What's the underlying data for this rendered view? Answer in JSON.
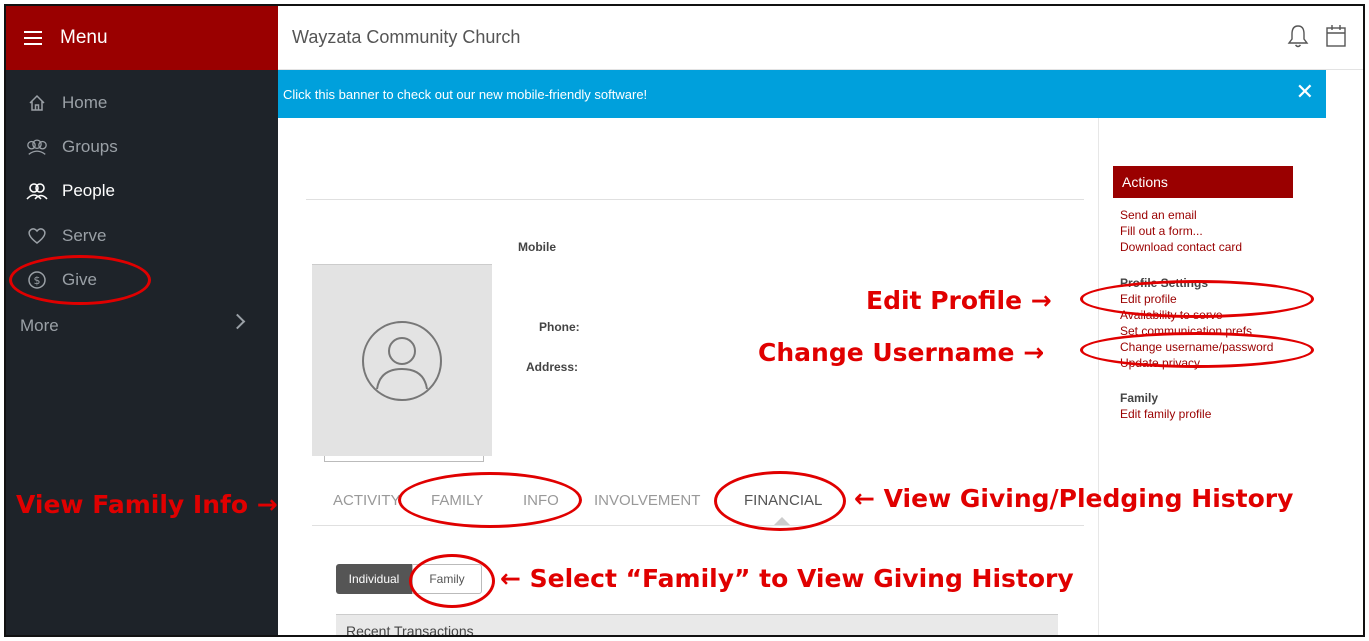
{
  "menu": {
    "label": "Menu"
  },
  "nav": {
    "home": "Home",
    "groups": "Groups",
    "people": "People",
    "serve": "Serve",
    "give": "Give",
    "more": "More"
  },
  "header": {
    "org_name": "Wayzata Community Church"
  },
  "banner": {
    "text": "Click this banner to check out our new mobile-friendly software!",
    "close": "✕"
  },
  "profile": {
    "mobile_label": "Mobile",
    "phone_label": "Phone:",
    "address_label": "Address:"
  },
  "tabs": [
    "ACTIVITY",
    "FAMILY",
    "INFO",
    "INVOLVEMENT",
    "FINANCIAL"
  ],
  "giving_toggle": {
    "individual": "Individual",
    "family": "Family"
  },
  "recent_transactions": "Recent Transactions",
  "actions": {
    "title": "Actions",
    "send_email": "Send an email",
    "fill_form": "Fill out a form...",
    "download_card": "Download contact card",
    "profile_settings_heading": "Profile Settings",
    "edit_profile": "Edit profile",
    "availability": "Availability to serve",
    "communication_prefs": "Set communication prefs",
    "change_username": "Change username/password",
    "update_privacy": "Update privacy",
    "family_heading": "Family",
    "edit_family_profile": "Edit family profile"
  },
  "annotations": {
    "edit_profile": "Edit Profile →",
    "change_username": "Change Username →",
    "view_family_info": "View Family Info →",
    "view_giving_history": "← View Giving/Pledging History",
    "select_family": "← Select “Family” to View Giving History"
  },
  "colors": {
    "brand": "#9a0000",
    "banner": "#00a0dc",
    "annotation": "#e00000",
    "sidebar": "#1e2329"
  }
}
